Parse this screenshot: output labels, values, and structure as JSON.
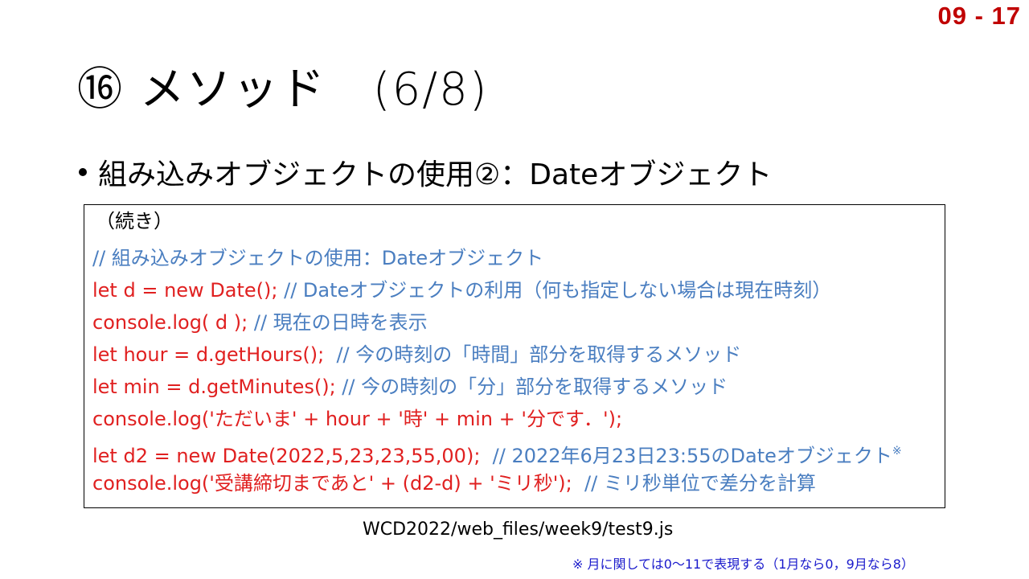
{
  "slide": {
    "page_number": "09 - 17",
    "title": "⑯ メソッド　(6/8)",
    "bullet": "組み込みオブジェクトの使用②：Dateオブジェクト",
    "continued_label": "（続き）",
    "file_path": "WCD2022/web_files/week9/test9.js",
    "footnote": "※ 月に関しては0～11で表現する（1月なら0，9月なら8）"
  },
  "code_lines": [
    {
      "code": "",
      "comment": "// 組み込みオブジェクトの使用：Dateオブジェクト",
      "mark": ""
    },
    {
      "code": "let d = new Date(); ",
      "comment": "// Dateオブジェクトの利用（何も指定しない場合は現在時刻）",
      "mark": ""
    },
    {
      "code": "console.log( d ); ",
      "comment": "// 現在の日時を表示",
      "mark": ""
    },
    {
      "code": "let hour = d.getHours();  ",
      "comment": "// 今の時刻の「時間」部分を取得するメソッド",
      "mark": ""
    },
    {
      "code": "let min = d.getMinutes(); ",
      "comment": "// 今の時刻の「分」部分を取得するメソッド",
      "mark": ""
    },
    {
      "code": "console.log('ただいま' + hour + '時' + min + '分です．');",
      "comment": "",
      "mark": ""
    },
    {
      "code": "let d2 = new Date(2022,5,23,23,55,00);  ",
      "comment": "// 2022年6月23日23:55のDateオブジェクト",
      "mark": "※"
    },
    {
      "code": "console.log('受講締切まであと' + (d2-d) + 'ミリ秒');  ",
      "comment": "// ミリ秒単位で差分を計算",
      "mark": ""
    }
  ],
  "colors": {
    "page_number": "#c00000",
    "code": "#e02020",
    "comment": "#4a7ec0",
    "footnote": "#1a1acc"
  }
}
